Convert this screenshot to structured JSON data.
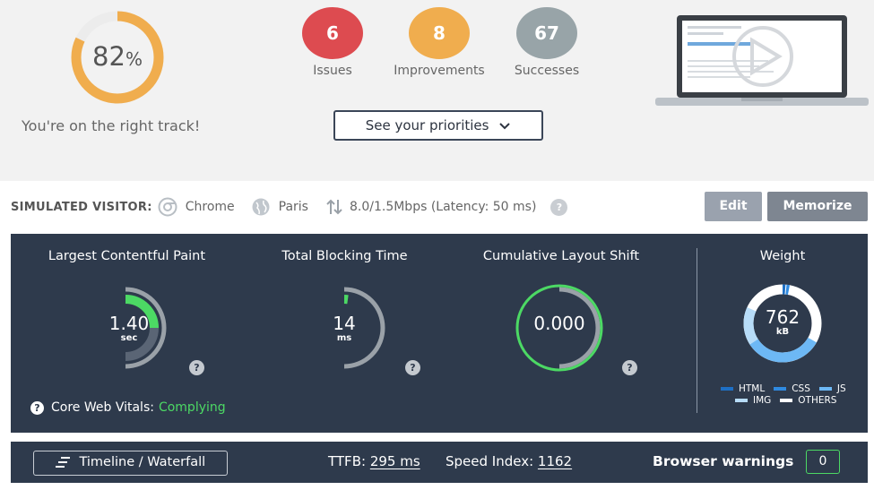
{
  "summary": {
    "score_value": "82",
    "score_unit": "%",
    "score_fraction": 0.82,
    "message": "You're on the right track!",
    "priorities_button": "See your priorities"
  },
  "stats": [
    {
      "count": "6",
      "label": "Issues",
      "color": "#dd4b50"
    },
    {
      "count": "8",
      "label": "Improvements",
      "color": "#f0ad4e"
    },
    {
      "count": "67",
      "label": "Successes",
      "color": "#98a4a8"
    }
  ],
  "visitor": {
    "caption": "SIMULATED VISITOR:",
    "browser": "Chrome",
    "location": "Paris",
    "connection": "8.0/1.5Mbps (Latency: 50 ms)",
    "edit_label": "Edit",
    "memorize_label": "Memorize"
  },
  "metrics": {
    "lcp": {
      "title": "Largest Contentful Paint",
      "value": "1.40",
      "unit": "sec"
    },
    "tbt": {
      "title": "Total Blocking Time",
      "value": "14",
      "unit": "ms"
    },
    "cls": {
      "title": "Cumulative Layout Shift",
      "value": "0.000"
    },
    "weight": {
      "title": "Weight",
      "value": "762",
      "unit": "kB"
    }
  },
  "core_web_vitals": {
    "label": "Core Web Vitals:",
    "status": "Complying"
  },
  "weight_legend": [
    {
      "label": "HTML",
      "color": "#1e6fc4"
    },
    {
      "label": "CSS",
      "color": "#2f8ae0"
    },
    {
      "label": "JS",
      "color": "#6db8f5"
    },
    {
      "label": "IMG",
      "color": "#b7dcf8"
    },
    {
      "label": "OTHERS",
      "color": "#ffffff"
    }
  ],
  "bottom": {
    "timeline_label": "Timeline / Waterfall",
    "ttfb_label": "TTFB:",
    "ttfb_value": "295 ms",
    "speed_label": "Speed Index:",
    "speed_value": "1162",
    "warnings_label": "Browser warnings",
    "warnings_count": "0"
  },
  "colors": {
    "accent_green": "#4cd964",
    "panel": "#2e3a4c",
    "score_orange": "#f0ad4e"
  }
}
